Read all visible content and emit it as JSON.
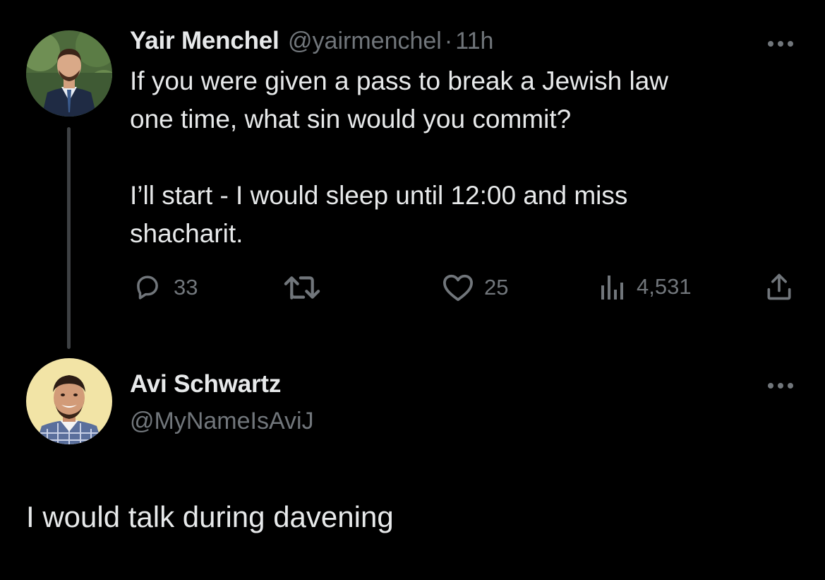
{
  "original_tweet": {
    "author_name": "Yair Menchel",
    "author_handle": "@yairmenchel",
    "separator": "·",
    "time": "11h",
    "text": "If you were given a pass to break a Jewish law\none time, what sin would you commit?\n\nI’ll start - I would sleep until 12:00 and miss\nshacharit.",
    "more_icon": "more-horizontal-icon",
    "actions": {
      "reply_count": "33",
      "repost_count": "",
      "like_count": "25",
      "views_count": "4,531"
    }
  },
  "reply_tweet": {
    "author_name": "Avi Schwartz",
    "author_handle": "@MyNameIsAviJ",
    "text": "I would talk during davening",
    "more_icon": "more-horizontal-icon"
  },
  "colors": {
    "background": "#000000",
    "primary_text": "#e7e9ea",
    "secondary_text": "#71767b",
    "thread_line": "#3e4144"
  }
}
